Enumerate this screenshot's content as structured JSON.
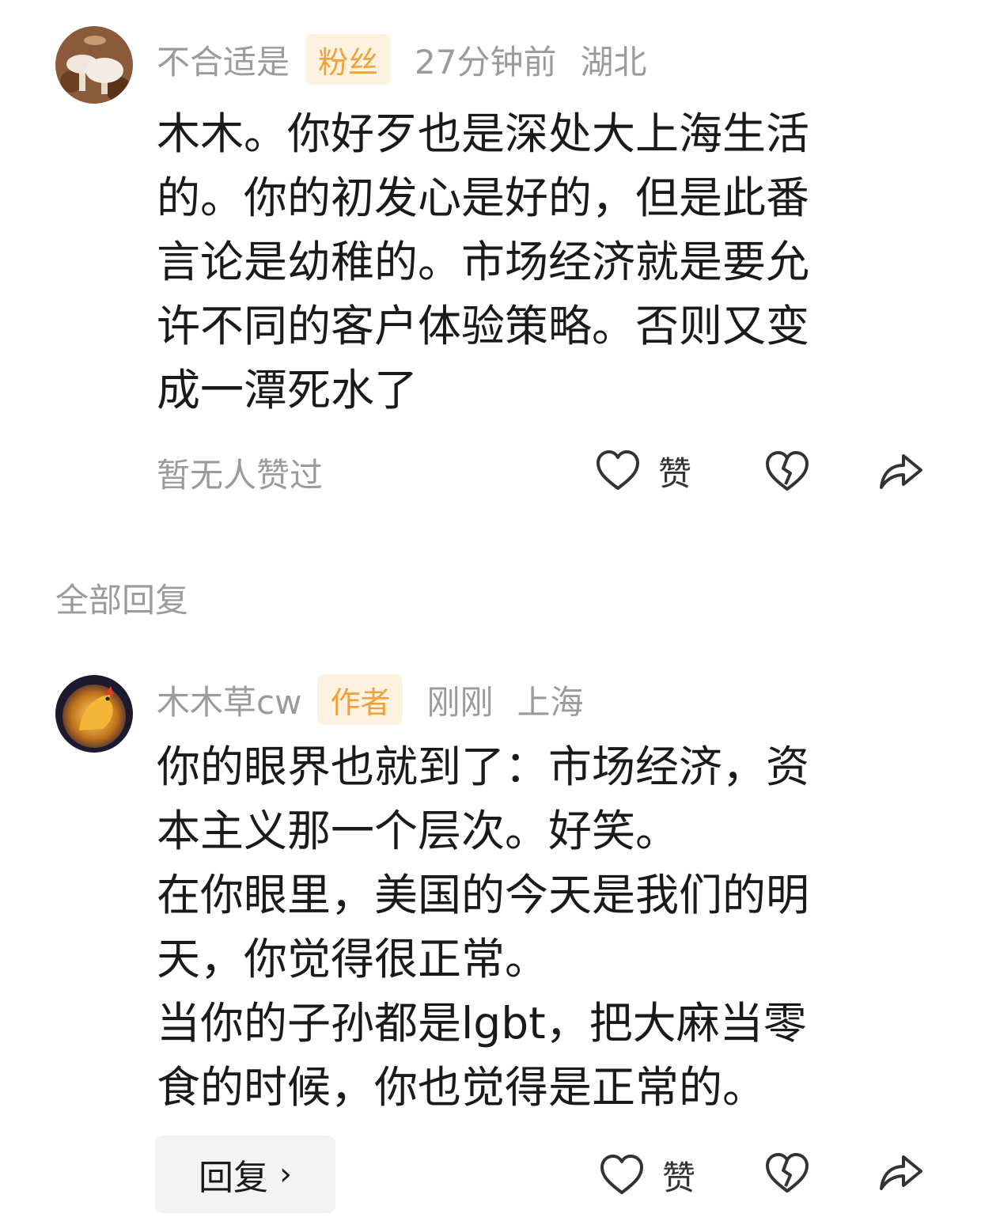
{
  "comment": {
    "username": "不合适是",
    "badge": "粉丝",
    "time": "27分钟前",
    "location": "湖北",
    "text": "木木。你好歹也是深处大上海生活\n的。你的初发心是好的，但是此番\n言论是幼稚的。市场经济就是要允\n许不同的客户体验策略。否则又变\n成一潭死水了",
    "no_likes_text": "暂无人赞过",
    "like_label": "赞",
    "icons": [
      "heart-icon",
      "broken-heart-icon",
      "share-icon"
    ]
  },
  "replies_section": {
    "title": "全部回复"
  },
  "reply": {
    "username": "木木草cw",
    "badge": "作者",
    "time": "刚刚",
    "location": "上海",
    "text": "你的眼界也就到了：市场经济，资\n本主义那一个层次。好笑。\n在你眼里，美国的今天是我们的明\n天，你觉得很正常。\n当你的子孙都是lgbt，把大麻当零\n食的时候，你也觉得是正常的。",
    "reply_button_label": "回复",
    "like_label": "赞",
    "icons": [
      "heart-icon",
      "broken-heart-icon",
      "share-icon"
    ]
  },
  "colors": {
    "badge_bg": "#fdf1df",
    "badge_text": "#f0a23a",
    "muted_text": "#9b9b9b",
    "body_text": "#1a1a1a"
  }
}
